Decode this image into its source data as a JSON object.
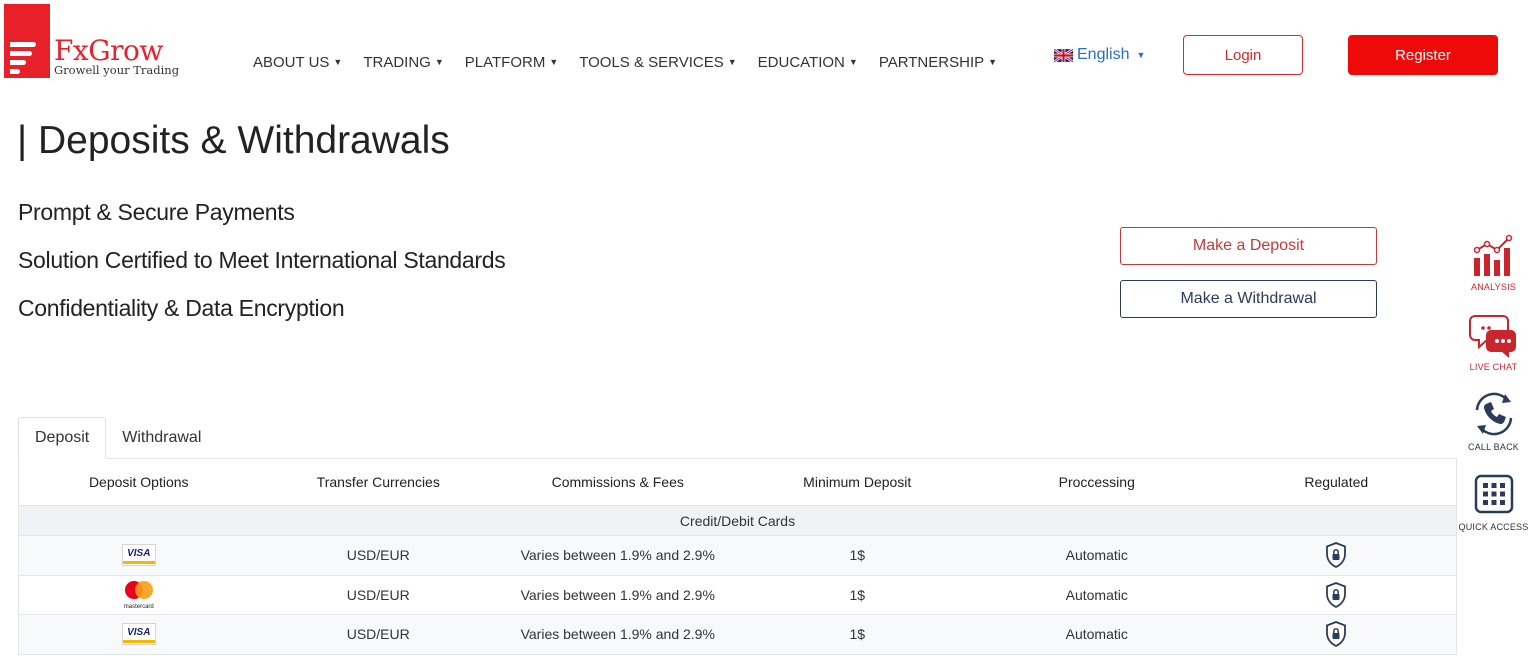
{
  "brand": {
    "name": "FxGrow",
    "tagline": "Growell your Trading",
    "accent": "#e8202a"
  },
  "nav": [
    {
      "label": "ABOUT US"
    },
    {
      "label": "TRADING"
    },
    {
      "label": "PLATFORM"
    },
    {
      "label": "TOOLS & SERVICES"
    },
    {
      "label": "EDUCATION"
    },
    {
      "label": "PARTNERSHIP"
    }
  ],
  "language": {
    "label": "English",
    "flag": "uk-flag-icon"
  },
  "auth": {
    "login": "Login",
    "register": "Register"
  },
  "page": {
    "title": "| Deposits & Withdrawals",
    "features": [
      "Prompt & Secure Payments",
      "Solution Certified to Meet International Standards",
      "Confidentiality & Data Encryption"
    ],
    "make_deposit": "Make a Deposit",
    "make_withdrawal": "Make a Withdrawal"
  },
  "side_widgets": [
    {
      "label": "ANALYSIS",
      "icon": "analysis-chart-icon"
    },
    {
      "label": "LIVE CHAT",
      "icon": "chat-bubbles-icon"
    },
    {
      "label": "CALL BACK",
      "icon": "phone-callback-icon"
    },
    {
      "label": "QUICK ACCESS",
      "icon": "grid-icon"
    }
  ],
  "tabs": [
    {
      "label": "Deposit",
      "active": true
    },
    {
      "label": "Withdrawal",
      "active": false
    }
  ],
  "table": {
    "headers": [
      "Deposit Options",
      "Transfer Currencies",
      "Commissions & Fees",
      "Minimum Deposit",
      "Proccessing",
      "Regulated"
    ],
    "group": "Credit/Debit Cards",
    "rows": [
      {
        "option": "visa-logo-icon",
        "currencies": "USD/EUR",
        "fees": "Varies between 1.9% and 2.9%",
        "min": "1$",
        "processing": "Automatic",
        "regulated": "shield-lock-icon"
      },
      {
        "option": "mastercard-logo-icon",
        "option_text": "mastercard",
        "currencies": "USD/EUR",
        "fees": "Varies between 1.9% and 2.9%",
        "min": "1$",
        "processing": "Automatic",
        "regulated": "shield-lock-icon"
      },
      {
        "option": "visa-logo-icon",
        "currencies": "USD/EUR",
        "fees": "Varies between 1.9% and 2.9%",
        "min": "1$",
        "processing": "Automatic",
        "regulated": "shield-lock-icon"
      }
    ]
  },
  "visa_text": "VISA"
}
